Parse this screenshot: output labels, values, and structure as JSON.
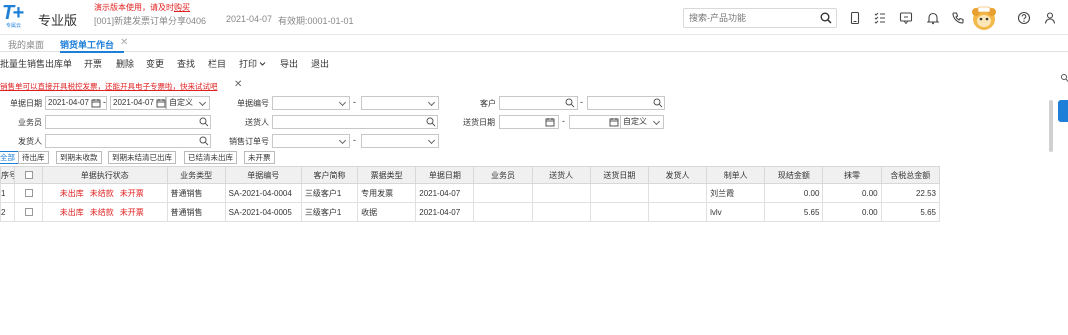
{
  "header": {
    "edition": "专业版",
    "logo_sub": "专属云",
    "demo_notice": "演示版本使用，请及时",
    "demo_link": "购买",
    "account": "[001]新建发票订单分享0406",
    "login_date": "2021-04-07",
    "period": "有效期:0001-01-01",
    "search_placeholder": "搜索-产品功能",
    "icons": [
      "search-icon",
      "mobile-icon",
      "checklist-icon",
      "message-icon",
      "bell-icon",
      "phone-icon",
      "mascot-icon",
      "help-icon",
      "user-icon"
    ]
  },
  "tabs": [
    {
      "label": "我的桌面"
    },
    {
      "label": "销货单工作台",
      "close": "✕"
    }
  ],
  "toolbar": [
    "批量生销售出库单",
    "开票",
    "删除",
    "变更",
    "查找",
    "栏目",
    "打印",
    "导出",
    "退出"
  ],
  "notice": {
    "text": "销售单可以直接开具税控发票，还能开具电子专票啦，快来试试吧",
    "close": "✕"
  },
  "filters": {
    "doc_date_label": "单据日期",
    "doc_date_from": "2021-04-07",
    "doc_date_to": "2021-04-07",
    "doc_date_range": "自定义",
    "doc_no_label": "单据编号",
    "customer_label": "客户",
    "salesman_label": "业务员",
    "deliverer_label": "送货人",
    "delivery_date_label": "送货日期",
    "delivery_date_range": "自定义",
    "sender_label": "发货人",
    "sales_order_label": "销售订单号",
    "dash": "-"
  },
  "filter_tabs": [
    "全部",
    "待出库",
    "到期未收款",
    "到期未结清已出库",
    "已结清未出库",
    "未开票"
  ],
  "table": {
    "columns": [
      "序号",
      "",
      "单据执行状态",
      "业务类型",
      "单据编号",
      "客户简称",
      "票据类型",
      "单据日期",
      "业务员",
      "送货人",
      "送货日期",
      "发货人",
      "制单人",
      "现结金额",
      "抹零",
      "含税总金额"
    ],
    "rows": [
      {
        "no": "1",
        "status": [
          "未出库",
          "未结款",
          "未开票"
        ],
        "biz_type": "普通销售",
        "doc_no": "SA-2021-04-0004",
        "customer": "三级客户1",
        "invoice_type": "专用发票",
        "doc_date": "2021-04-07",
        "salesman": "",
        "deliverer": "",
        "delivery_date": "",
        "sender": "",
        "maker": "刘兰霞",
        "cash": "0.00",
        "rounding": "0.00",
        "total": "22.53"
      },
      {
        "no": "2",
        "status": [
          "未出库",
          "未结款",
          "未开票"
        ],
        "biz_type": "普通销售",
        "doc_no": "SA-2021-04-0005",
        "customer": "三级客户1",
        "invoice_type": "收据",
        "doc_date": "2021-04-07",
        "salesman": "",
        "deliverer": "",
        "delivery_date": "",
        "sender": "",
        "maker": "lvlv",
        "cash": "5.65",
        "rounding": "0.00",
        "total": "5.65"
      }
    ]
  },
  "colors": {
    "accent": "#1e7fd8",
    "alert": "#e02020"
  }
}
